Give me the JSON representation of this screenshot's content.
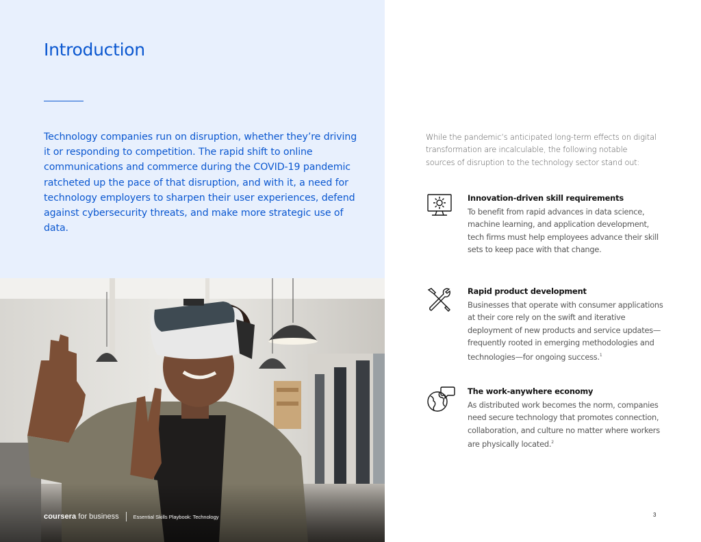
{
  "intro_panel": {
    "title": "Introduction",
    "body": "Technology companies run on disruption, whether they’re driving it or responding to competition. The rapid shift to online communications and commerce during the COVID-19 pandemic ratcheted up the pace of that disruption, and with it, a need for technology employers to sharpen their user experiences, defend against cybersecurity threats, and make more strategic use of data."
  },
  "right_column": {
    "intro": "While the pandemic’s anticipated long-term effects on digital transformation are incalculable, the following notable sources of disruption to the technology sector stand out:",
    "items": [
      {
        "icon": "computer-gear-icon",
        "heading": "Innovation-driven skill requirements",
        "body": "To benefit from rapid advances in data science, machine learning, and application development, tech firms must help employees advance their skill sets to keep pace with that change.",
        "footnote": ""
      },
      {
        "icon": "tools-icon",
        "heading": "Rapid product development",
        "body": "Businesses that operate with consumer applications at their core rely on the swift and iterative deployment of new products and service updates—frequently rooted in emerging methodologies and technologies—for ongoing success.",
        "footnote": "1"
      },
      {
        "icon": "globe-chat-icon",
        "heading": "The work-anywhere economy",
        "body": "As distributed work becomes the norm, companies need secure technology that promotes connection, collaboration, and culture no matter where workers are physically located.",
        "footnote": "2"
      }
    ]
  },
  "footer": {
    "brand": "coursera",
    "brand_suffix": "for business",
    "doc_title": "Essential Skills Playbook: Technology",
    "page_number": "3"
  },
  "colors": {
    "accent_blue": "#0a57d0",
    "panel_bg": "#e8f0fd"
  }
}
